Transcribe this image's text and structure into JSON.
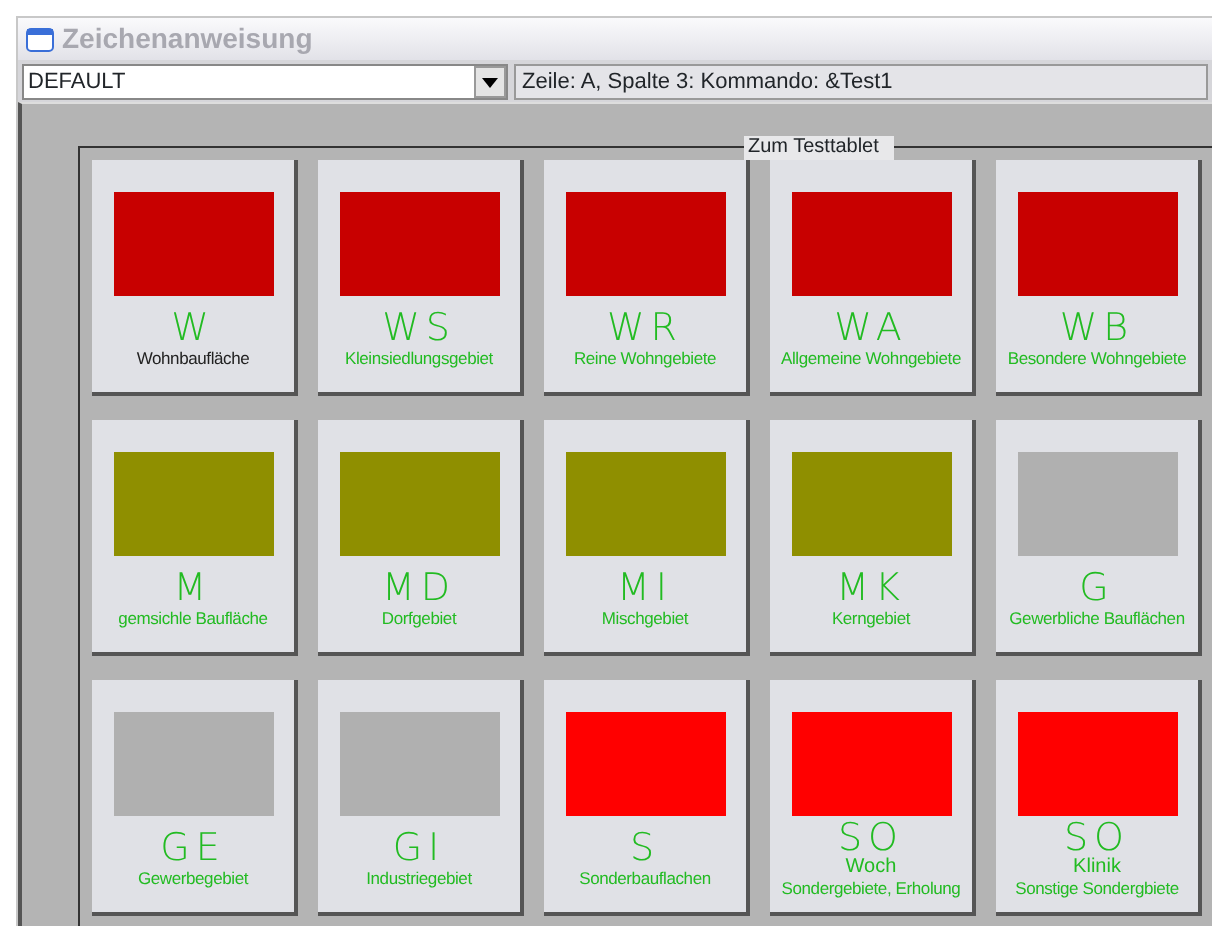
{
  "window": {
    "title": "Zeichenanweisung"
  },
  "toolbar": {
    "profile": "DEFAULT",
    "status": "Zeile: A, Spalte 3: Kommando: &Test1"
  },
  "panel": {
    "label": "Zum Testtablet"
  },
  "tiles": [
    {
      "code": "W",
      "caption": "Wohnbaufläche",
      "color": "#c80000",
      "selected": true
    },
    {
      "code": "WS",
      "caption": "Kleinsiedlungsgebiet",
      "color": "#c80000",
      "selected": false
    },
    {
      "code": "WR",
      "caption": "Reine Wohngebiete",
      "color": "#c80000",
      "selected": false
    },
    {
      "code": "WA",
      "caption": "Allgemeine Wohngebiete",
      "color": "#c80000",
      "selected": false
    },
    {
      "code": "WB",
      "caption": "Besondere Wohngebiete",
      "color": "#c80000",
      "selected": false
    },
    {
      "code": "M",
      "caption": "gemsichle Baufläche",
      "color": "#8f8f00",
      "selected": false
    },
    {
      "code": "MD",
      "caption": "Dorfgebiet",
      "color": "#8f8f00",
      "selected": false
    },
    {
      "code": "MI",
      "caption": "Mischgebiet",
      "color": "#8f8f00",
      "selected": false
    },
    {
      "code": "MK",
      "caption": "Kerngebiet",
      "color": "#8f8f00",
      "selected": false
    },
    {
      "code": "G",
      "caption": "Gewerbliche Bauflächen",
      "color": "#b0b0b0",
      "selected": false
    },
    {
      "code": "GE",
      "caption": "Gewerbegebiet",
      "color": "#b0b0b0",
      "selected": false
    },
    {
      "code": "GI",
      "caption": "Industriegebiet",
      "color": "#b0b0b0",
      "selected": false
    },
    {
      "code": "S",
      "caption": "Sonderbauflachen",
      "color": "#ff0000",
      "selected": false
    },
    {
      "code": "SO",
      "subtitle": "Woch",
      "caption": "Sondergebiete, Erholung",
      "color": "#ff0000",
      "selected": false
    },
    {
      "code": "SO",
      "subtitle": "Klinik",
      "caption": "Sonstige Sondergbiete",
      "color": "#ff0000",
      "selected": false
    }
  ]
}
